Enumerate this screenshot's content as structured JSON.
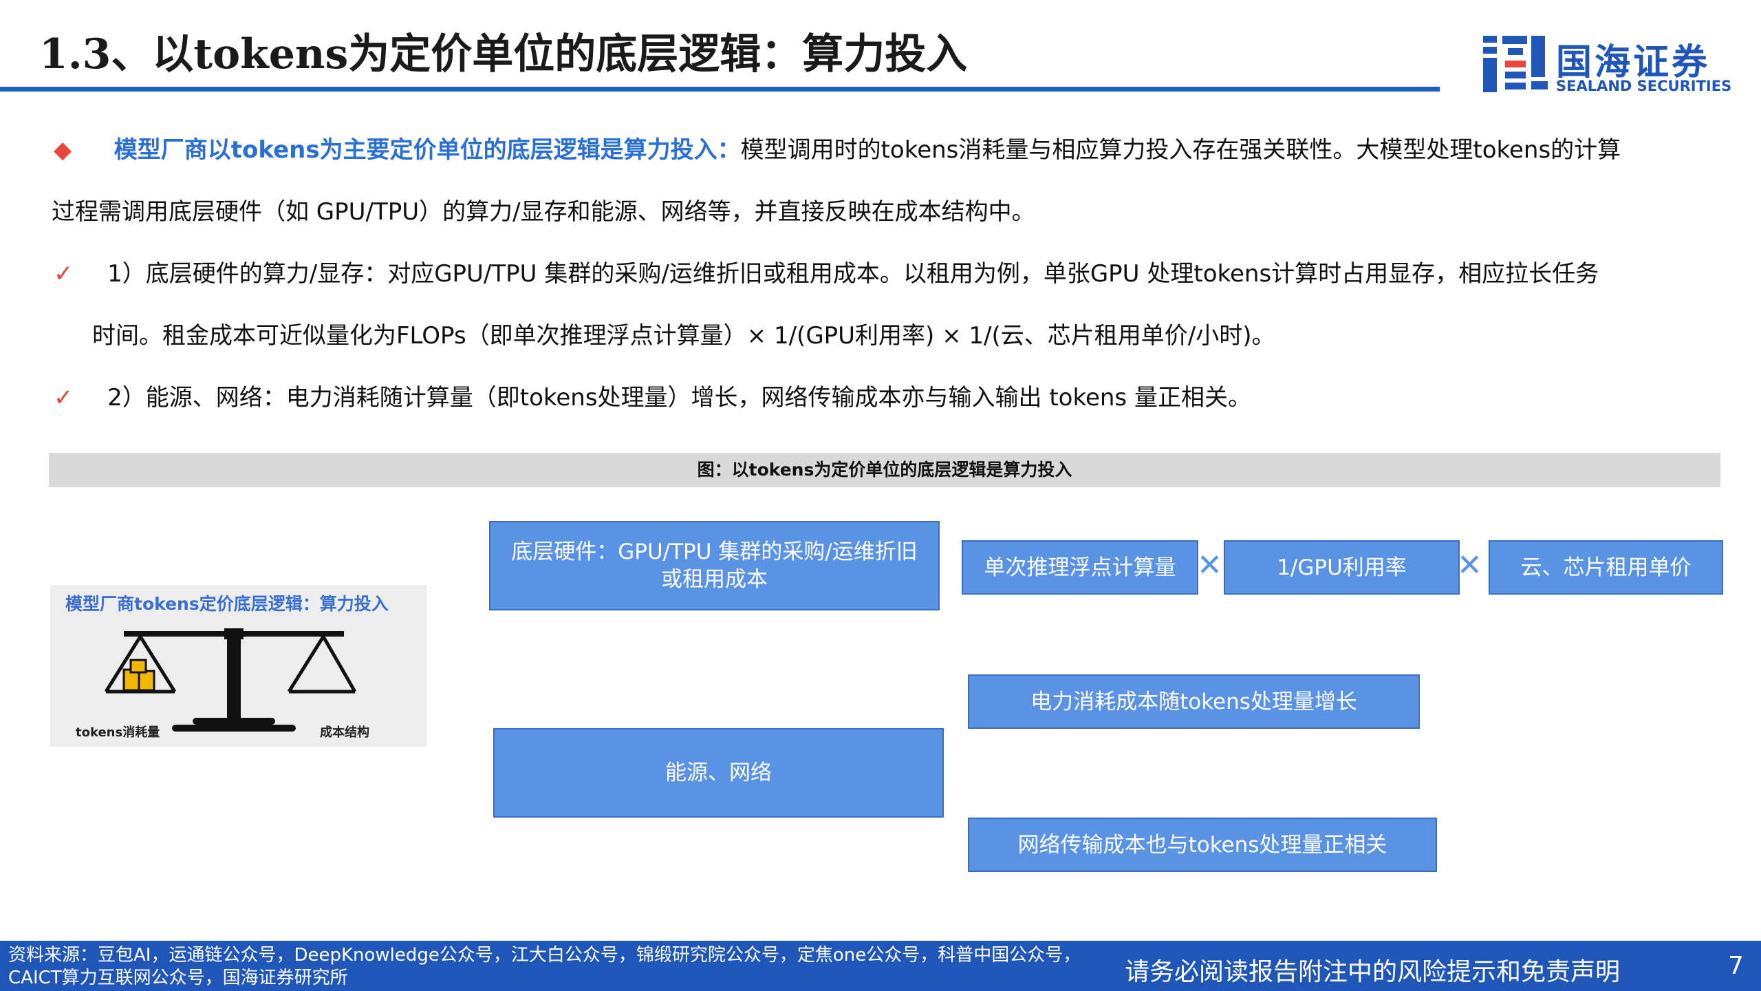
{
  "header": {
    "title": "1.3、以tokens为定价单位的底层逻辑：算力投入",
    "logo_cn": "国海证券",
    "logo_en": "SEALAND SECURITIES"
  },
  "content": {
    "p1_highlight": "模型厂商以tokens为主要定价单位的底层逻辑是算力投入：",
    "p1_rest": "模型调用时的tokens消耗量与相应算力投入存在强关联性。大模型处理tokens的计算",
    "p1_line2": "过程需调用底层硬件（如 GPU/TPU）的算力/显存和能源、网络等，并直接反映在成本结构中。",
    "p2_line1": "1）底层硬件的算力/显存：对应GPU/TPU 集群的采购/运维折旧或租用成本。以租用为例，单张GPU 处理tokens计算时占用显存，相应拉长任务",
    "p2_line2": "时间。租金成本可近似量化为FLOPs（即单次推理浮点计算量）× 1/(GPU利用率) × 1/(云、芯片租用单价/小时)。",
    "p3_line1": "2）能源、网络：电力消耗随计算量（即tokens处理量）增长，网络传输成本亦与输入输出 tokens 量正相关。",
    "bullet_diamond": "◆",
    "bullet_check": "✓"
  },
  "figure": {
    "caption": "图：以tokens为定价单位的底层逻辑是算力投入",
    "scale_title": "模型厂商tokens定价底层逻辑：算力投入",
    "scale_left_label": "tokens消耗量",
    "scale_right_label": "成本结构",
    "box_hardware": "底层硬件：GPU/TPU 集群的采购/运维折旧或租用成本",
    "box_flops": "单次推理浮点计算量",
    "box_gpu_util": "1/GPU利用率",
    "box_cloud_price": "云、芯片租用单价",
    "box_energy_network": "能源、网络",
    "box_power": "电力消耗成本随tokens处理量增长",
    "box_network": "网络传输成本也与tokens处理量正相关",
    "multiply_sign": "✕"
  },
  "footer": {
    "source_line1": "资料来源：豆包AI，运通链公众号，DeepKnowledge公众号，江大白公众号，锦缎研究院公众号，定焦one公众号，科普中国公众号，",
    "source_line2": "CAICT算力互联网公众号，国海证券研究所",
    "disclaimer": "请务必阅读报告附注中的风险提示和免责声明",
    "page_number": "7"
  },
  "colors": {
    "brand_blue": "#1f56b8",
    "box_blue": "#5a93e6",
    "highlight_blue": "#2a6fd6",
    "bullet_red": "#e8463a"
  }
}
